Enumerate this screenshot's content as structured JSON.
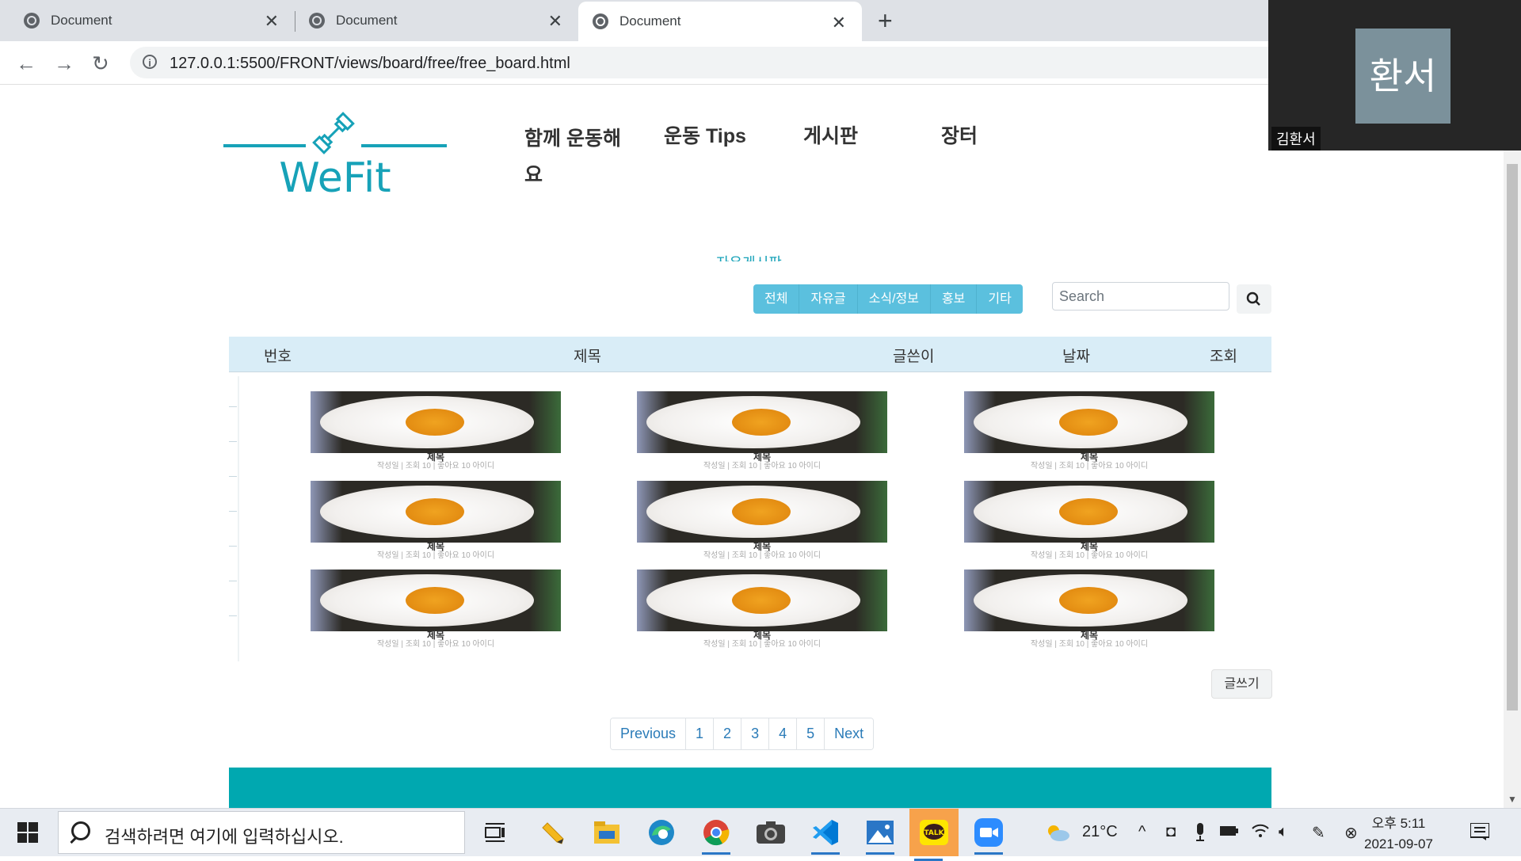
{
  "browser": {
    "tabs": [
      {
        "title": "Document"
      },
      {
        "title": "Document"
      },
      {
        "title": "Document"
      }
    ],
    "url": "127.0.0.1:5500/FRONT/views/board/free/free_board.html"
  },
  "site": {
    "logo_text": "WeFit",
    "brand_color": "#17a2b8",
    "nav": [
      "함께 운동해요",
      "운동 Tips",
      "게시판",
      "장터"
    ],
    "category_title": "자유게시판"
  },
  "filters": [
    "전체",
    "자유글",
    "소식/정보",
    "홍보",
    "기타"
  ],
  "search": {
    "placeholder": "Search"
  },
  "table_headers": [
    "번호",
    "제목",
    "글쓴이",
    "날짜",
    "조회"
  ],
  "cards": [
    {
      "title": "제목",
      "meta": "작성일 | 조회 10 | 좋아요 10",
      "author": "아이디"
    },
    {
      "title": "제목",
      "meta": "작성일 | 조회 10 | 좋아요 10",
      "author": "아이디"
    },
    {
      "title": "제목",
      "meta": "작성일 | 조회 10 | 좋아요 10",
      "author": "아이디"
    },
    {
      "title": "제목",
      "meta": "작성일 | 조회 10 | 좋아요 10",
      "author": "아이디"
    },
    {
      "title": "제목",
      "meta": "작성일 | 조회 10 | 좋아요 10",
      "author": "아이디"
    },
    {
      "title": "제목",
      "meta": "작성일 | 조회 10 | 좋아요 10",
      "author": "아이디"
    },
    {
      "title": "제목",
      "meta": "작성일 | 조회 10 | 좋아요 10",
      "author": "아이디"
    },
    {
      "title": "제목",
      "meta": "작성일 | 조회 10 | 좋아요 10",
      "author": "아이디"
    },
    {
      "title": "제목",
      "meta": "작성일 | 조회 10 | 좋아요 10",
      "author": "아이디"
    }
  ],
  "write_button": "글쓰기",
  "pagination": [
    "Previous",
    "1",
    "2",
    "3",
    "4",
    "5",
    "Next"
  ],
  "footer_color": "#00a8b0",
  "zoom": {
    "avatar_text": "환서",
    "name": "김환서"
  },
  "taskbar": {
    "search_placeholder": "검색하려면 여기에 입력하십시오.",
    "weather": "21°C",
    "time": "오후 5:11",
    "date": "2021-09-07",
    "apps": [
      "task-view-icon",
      "pencil-icon",
      "file-explorer-icon",
      "edge-icon",
      "chrome-icon",
      "camera-icon",
      "vscode-icon",
      "photos-icon",
      "kakaotalk-icon",
      "zoom-icon"
    ]
  }
}
